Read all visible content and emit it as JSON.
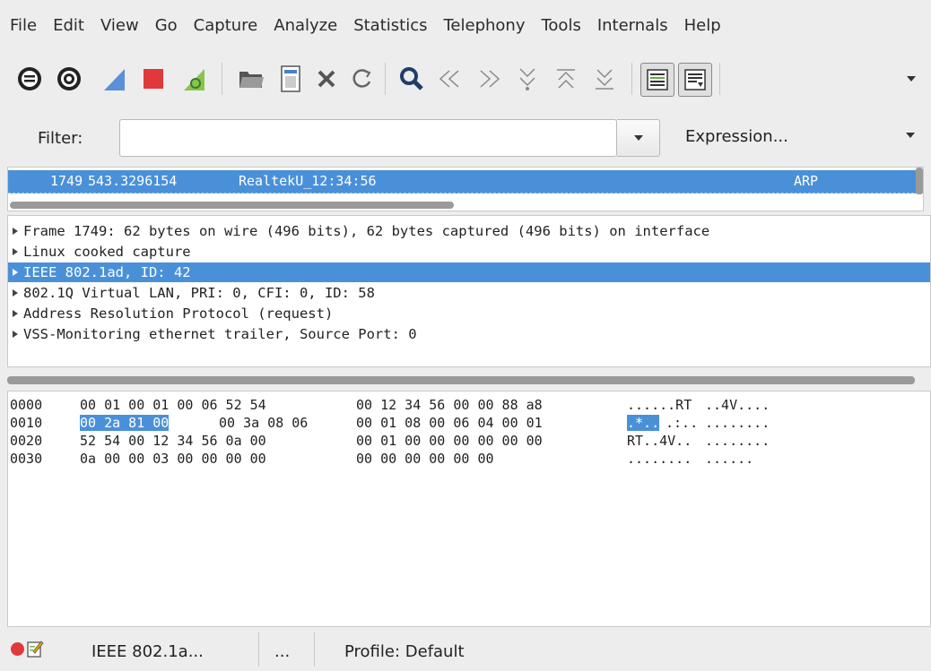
{
  "menu": [
    "File",
    "Edit",
    "View",
    "Go",
    "Capture",
    "Analyze",
    "Statistics",
    "Telephony",
    "Tools",
    "Internals",
    "Help"
  ],
  "toolbar": {
    "icons": [
      "interfaces-icon",
      "options-icon",
      "start-capture-icon",
      "stop-capture-icon",
      "restart-capture-icon",
      "open-file-icon",
      "save-file-icon",
      "close-file-icon",
      "reload-icon",
      "find-icon",
      "go-back-icon",
      "go-forward-icon",
      "go-to-packet-icon",
      "go-first-icon",
      "go-last-icon",
      "colorize-icon",
      "auto-scroll-icon",
      "more-icon"
    ]
  },
  "filter": {
    "label": "Filter:",
    "value": "",
    "expression_label": "Expression..."
  },
  "packet_list": {
    "rows": [
      {
        "no": "1749",
        "time": "543.3296154",
        "source": "RealtekU_12:34:56",
        "protocol": "ARP"
      }
    ]
  },
  "details": [
    {
      "text": "Frame 1749: 62 bytes on wire (496 bits), 62 bytes captured (496 bits) on interface",
      "selected": false
    },
    {
      "text": "Linux cooked capture",
      "selected": false
    },
    {
      "text": "IEEE 802.1ad, ID: 42",
      "selected": true
    },
    {
      "text": "802.1Q Virtual LAN, PRI: 0, CFI: 0, ID: 58",
      "selected": false
    },
    {
      "text": "Address Resolution Protocol (request)",
      "selected": false
    },
    {
      "text": "VSS-Monitoring ethernet trailer, Source Port: 0",
      "selected": false
    }
  ],
  "bytes": [
    {
      "offset": "0000",
      "hex_a": "00 01 00 01 00 06 52 54",
      "hex_b": "00 12 34 56 00 00 88 a8",
      "ascii_a": "......RT",
      "ascii_b": "..4V...."
    },
    {
      "offset": "0010",
      "hex_sel": "00 2a 81 00",
      "hex_a_rest": "00 3a 08 06",
      "hex_b": "00 01 08 00 06 04 00 01",
      "ascii_sel": ".*..",
      "ascii_a_rest": ".:..",
      "ascii_b": "........"
    },
    {
      "offset": "0020",
      "hex_a": "52 54 00 12 34 56 0a 00",
      "hex_b": "00 01 00 00 00 00 00 00",
      "ascii_a": "RT..4V..",
      "ascii_b": "........"
    },
    {
      "offset": "0030",
      "hex_a": "0a 00 00 03 00 00 00 00",
      "hex_b": "00 00 00 00 00 00",
      "ascii_a": "........",
      "ascii_b": "......"
    }
  ],
  "status": {
    "field": "IEEE 802.1a...",
    "packets": "...",
    "profile": "Profile: Default"
  },
  "colors": {
    "selection": "#4a90d9",
    "stop_red": "#e0393c",
    "shark_blue": "#5b8fd8",
    "shark_green": "#4caf50"
  }
}
